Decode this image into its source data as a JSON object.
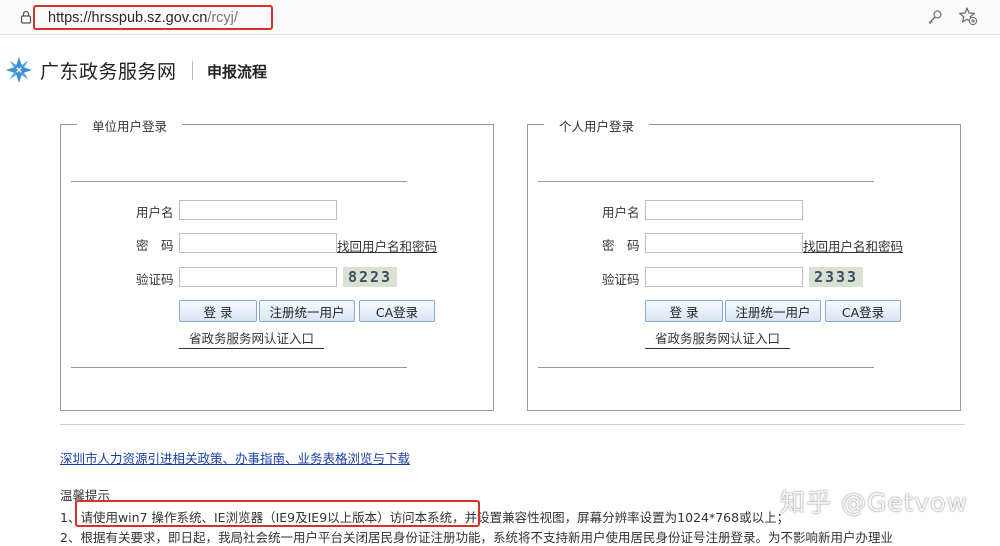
{
  "browser": {
    "url_host": "https://hrsspub.sz.gov.cn",
    "url_path": "/rcyj/",
    "icons": [
      "lock-icon",
      "key-icon",
      "favorite-star-icon"
    ]
  },
  "header": {
    "site_name": "广东政务服务网",
    "page_title": "申报流程",
    "accent": "#3a8fd6"
  },
  "panels": [
    {
      "title": "单位用户登录",
      "username_label": "用户名",
      "password_label": "密　码",
      "captcha_label": "验证码",
      "forgot_link": "找回用户名和密码",
      "captcha_code": "8223",
      "login_button": "登 录",
      "register_button": "注册统一用户",
      "ca_button": "CA登录",
      "cert_link": "省政务服务网认证入口"
    },
    {
      "title": "个人用户登录",
      "username_label": "用户名",
      "password_label": "密　码",
      "captcha_label": "验证码",
      "forgot_link": "找回用户名和密码",
      "captcha_code": "2333",
      "login_button": "登 录",
      "register_button": "注册统一用户",
      "ca_button": "CA登录",
      "cert_link": "省政务服务网认证入口"
    }
  ],
  "footer": {
    "policy_link": "深圳市人力资源引进相关政策、办事指南、业务表格浏览与下载",
    "tips_title": "温馨提示",
    "tips": [
      "1、请使用win7 操作系统、IE浏览器（IE9及IE9以上版本）访问本系统，并设置兼容性视图，屏幕分辨率设置为1024*768或以上；",
      "2、根据有关要求，即日起，我局社会统一用户平台关闭居民身份证注册功能，系统将不支持新用户使用居民身份证号注册登录。为不影响新用户办理业"
    ],
    "highlight_color": "#d9302f"
  },
  "watermark": "知乎 @Getvow"
}
